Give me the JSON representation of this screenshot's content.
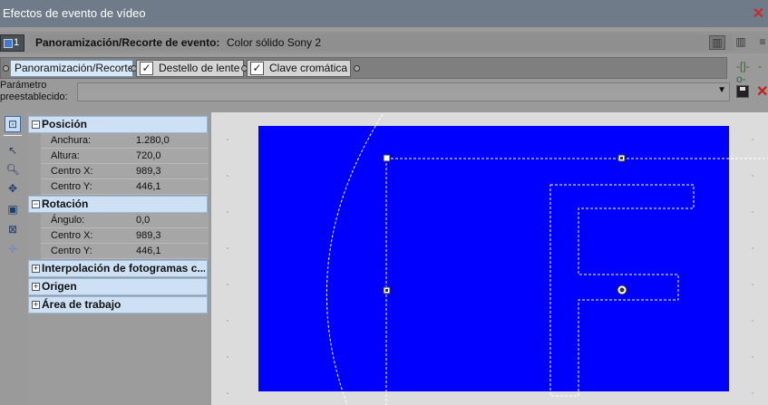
{
  "window": {
    "title": "Efectos de evento de vídeo"
  },
  "event": {
    "chain_number": "1",
    "label": "Panoramización/Recorte de evento:",
    "source": "Color sólido Sony 2"
  },
  "effects": {
    "tabs": [
      {
        "label": "Panoramización/Recorte",
        "active": true,
        "checked": false
      },
      {
        "label": "Destello de lente",
        "active": false,
        "checked": true
      },
      {
        "label": "Clave cromática",
        "active": false,
        "checked": true
      }
    ]
  },
  "preset": {
    "label_line1": "Parámetro",
    "label_line2": "preestablecido:",
    "value": ""
  },
  "properties": {
    "sections": [
      {
        "label": "Posición",
        "expanded": true,
        "rows": [
          {
            "name": "Anchura:",
            "value": "1.280,0"
          },
          {
            "name": "Altura:",
            "value": "720,0"
          },
          {
            "name": "Centro X:",
            "value": "989,3"
          },
          {
            "name": "Centro Y:",
            "value": "446,1"
          }
        ]
      },
      {
        "label": "Rotación",
        "expanded": true,
        "rows": [
          {
            "name": "Ángulo:",
            "value": "0,0"
          },
          {
            "name": "Centro X:",
            "value": "989,3"
          },
          {
            "name": "Centro Y:",
            "value": "446,1"
          }
        ]
      },
      {
        "label": "Interpolación de fotogramas c...",
        "expanded": false,
        "rows": []
      },
      {
        "label": "Origen",
        "expanded": false,
        "rows": []
      },
      {
        "label": "Área de trabajo",
        "expanded": false,
        "rows": []
      }
    ]
  },
  "canvas": {
    "background_color": "#0000ff",
    "letter": "F"
  },
  "colors": {
    "accent": "#3c6aa8",
    "section_bg": "#cde0f4",
    "title_bg": "#6f7b89"
  }
}
